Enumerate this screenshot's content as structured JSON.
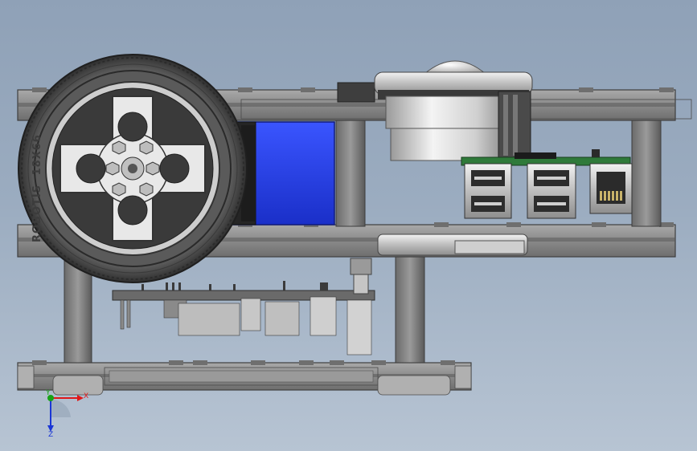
{
  "viewport": {
    "background_top": "#8fa1b7",
    "background_bottom": "#b7c4d3"
  },
  "model": {
    "wheel": {
      "tire_marking_brand": "ROBOTIS",
      "tire_marking_size": "18X66"
    },
    "colors": {
      "frame": "#8d8d8d",
      "frame_dark": "#5d5d5d",
      "motor": "#2a3fe0",
      "pcb": "#2f7a3a",
      "ball": "#e6e6e6",
      "metal": "#c9c9c9"
    }
  },
  "triad": {
    "x_label": "X",
    "y_label": "Y",
    "z_label": "Z",
    "x_color": "#e01818",
    "y_color": "#17a317",
    "z_color": "#1a36d6"
  }
}
